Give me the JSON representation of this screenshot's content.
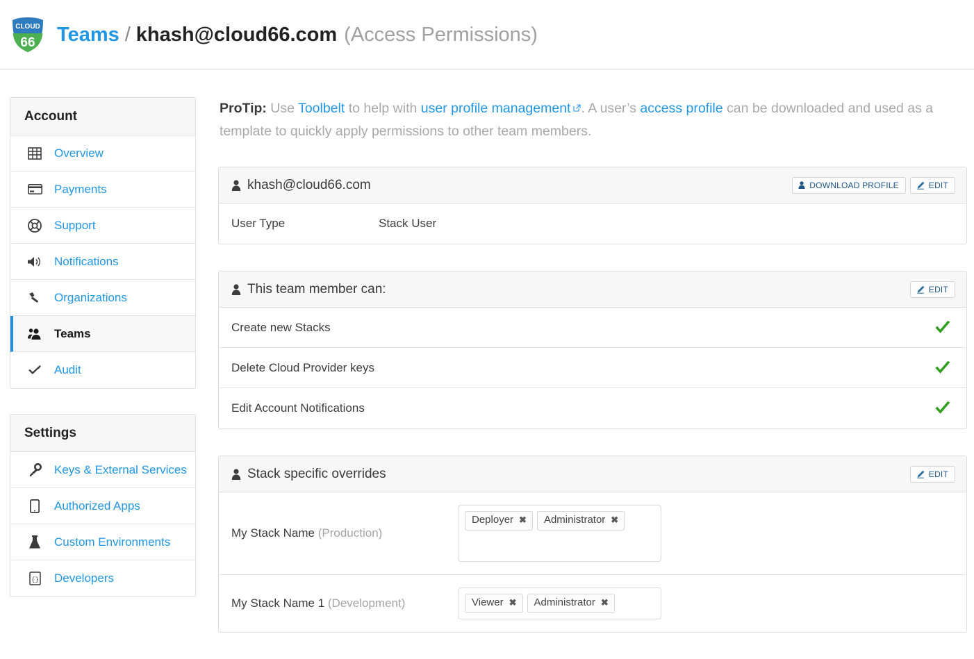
{
  "header": {
    "logo_alt": "Cloud 66",
    "logo_top_text": "CLOUD",
    "logo_bottom_text": "66",
    "breadcrumb_root": "Teams",
    "breadcrumb_separator": "/",
    "breadcrumb_current": "khash@cloud66.com",
    "breadcrumb_subtitle": "(Access Permissions)",
    "link_color": "#2196e3"
  },
  "sidebar": {
    "account": {
      "title": "Account",
      "items": [
        {
          "label": "Overview",
          "icon": "table-icon",
          "active": false
        },
        {
          "label": "Payments",
          "icon": "credit-card-icon",
          "active": false
        },
        {
          "label": "Support",
          "icon": "life-ring-icon",
          "active": false
        },
        {
          "label": "Notifications",
          "icon": "volume-icon",
          "active": false
        },
        {
          "label": "Organizations",
          "icon": "hammer-icon",
          "active": false
        },
        {
          "label": "Teams",
          "icon": "users-icon",
          "active": true
        },
        {
          "label": "Audit",
          "icon": "check-icon",
          "active": false
        }
      ]
    },
    "settings": {
      "title": "Settings",
      "items": [
        {
          "label": "Keys & External Services",
          "icon": "key-icon"
        },
        {
          "label": "Authorized Apps",
          "icon": "tablet-icon"
        },
        {
          "label": "Custom Environments",
          "icon": "flask-icon"
        },
        {
          "label": "Developers",
          "icon": "code-file-icon"
        }
      ]
    }
  },
  "protip": {
    "label": "ProTip:",
    "text_1": " Use ",
    "link_toolbelt": "Toolbelt",
    "text_2": " to help with ",
    "link_user_profile_management": "user profile management",
    "external_icon": "external-link-icon",
    "text_3": ". A user’s ",
    "link_access_profile": "access profile",
    "text_4": " can be downloaded and used as a template to quickly apply permissions to other team members."
  },
  "panels": {
    "user": {
      "icon": "user-icon",
      "title": "khash@cloud66.com",
      "buttons": [
        {
          "label": "DOWNLOAD PROFILE",
          "icon": "user-icon"
        },
        {
          "label": "EDIT",
          "icon": "pencil-icon"
        }
      ],
      "rows": [
        {
          "label": "User Type",
          "value": "Stack User"
        }
      ]
    },
    "permissions": {
      "icon": "user-icon",
      "title": "This team member can:",
      "buttons": [
        {
          "label": "EDIT",
          "icon": "pencil-icon"
        }
      ],
      "check_color": "#2f9e1c",
      "rows": [
        {
          "label": "Create new Stacks",
          "granted": true,
          "check": "check-icon"
        },
        {
          "label": "Delete Cloud Provider keys",
          "granted": true,
          "check": "check-icon"
        },
        {
          "label": "Edit Account Notifications",
          "granted": true,
          "check": "check-icon"
        }
      ]
    },
    "overrides": {
      "icon": "user-icon",
      "title": "Stack specific overrides",
      "buttons": [
        {
          "label": "EDIT",
          "icon": "pencil-icon"
        }
      ],
      "rows": [
        {
          "stack_name": "My Stack Name",
          "environment": "(Production)",
          "tall": true,
          "tags": [
            {
              "label": "Deployer",
              "remove": "✖"
            },
            {
              "label": "Administrator",
              "remove": "✖"
            }
          ]
        },
        {
          "stack_name": "My Stack Name 1",
          "environment": "(Development)",
          "tall": false,
          "tags": [
            {
              "label": "Viewer",
              "remove": "✖"
            },
            {
              "label": "Administrator",
              "remove": "✖"
            }
          ]
        }
      ]
    }
  }
}
